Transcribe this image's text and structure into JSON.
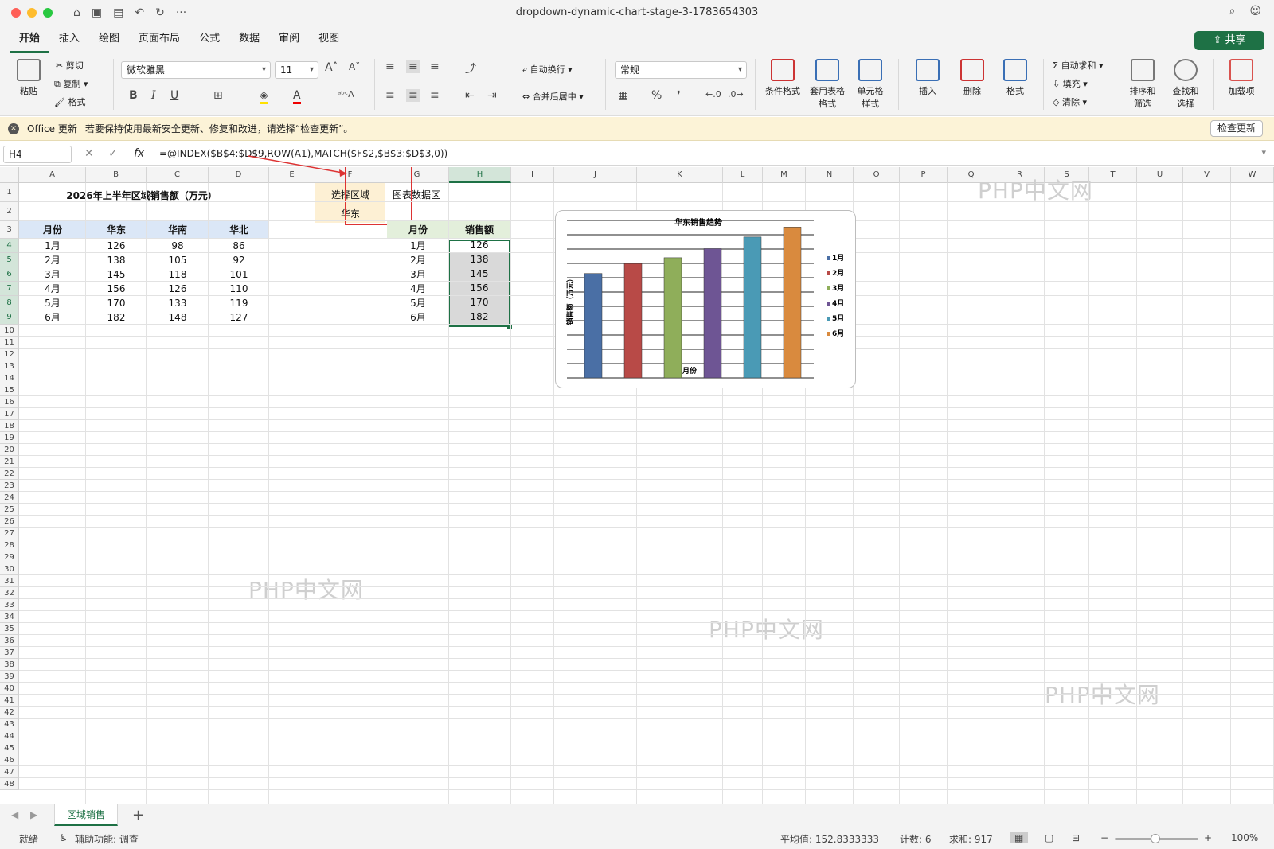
{
  "window": {
    "title": "dropdown-dynamic-chart-stage-3-1783654303"
  },
  "tabs": [
    "开始",
    "插入",
    "绘图",
    "页面布局",
    "公式",
    "数据",
    "审阅",
    "视图"
  ],
  "share_label": "共享",
  "ribbon": {
    "paste": "粘贴",
    "cut": "剪切",
    "copy": "复制",
    "format_painter": "格式",
    "font_name": "微软雅黑",
    "font_size": "11",
    "bold": "B",
    "italic": "I",
    "underline": "U",
    "wrap_text": "自动换行",
    "merge_center": "合并后居中",
    "number_format": "常规",
    "percent": "%",
    "comma": "❜",
    "conditional_format": "条件格式",
    "format_table_1": "套用表格",
    "format_table_2": "格式",
    "cell_style_1": "单元格",
    "cell_style_2": "样式",
    "insert": "插入",
    "delete": "删除",
    "format": "格式",
    "autosum": "自动求和",
    "fill": "填充",
    "clear": "清除",
    "sort_1": "排序和",
    "sort_2": "筛选",
    "find_1": "查找和",
    "find_2": "选择",
    "addins": "加载项"
  },
  "message": {
    "app": "Office 更新",
    "text": "若要保持使用最新安全更新、修复和改进，请选择“检查更新”。",
    "button": "检查更新"
  },
  "formula_bar": {
    "name_box": "H4",
    "fx": "fx",
    "formula": "=@INDEX($B$4:$D$9,ROW(A1),MATCH($F$2,$B$3:$D$3,0))"
  },
  "columns": [
    "A",
    "B",
    "C",
    "D",
    "E",
    "F",
    "G",
    "H",
    "I",
    "J",
    "K",
    "L",
    "M",
    "N",
    "O",
    "P",
    "Q",
    "R",
    "S",
    "T",
    "U",
    "V",
    "W"
  ],
  "rows": [
    "1",
    "2",
    "3",
    "4",
    "5",
    "6",
    "7",
    "8",
    "9",
    "10",
    "11",
    "12",
    "13",
    "14",
    "15",
    "16",
    "17",
    "18",
    "19",
    "20",
    "21",
    "22",
    "23",
    "24",
    "25",
    "26",
    "27",
    "28",
    "29",
    "30",
    "31",
    "32",
    "33",
    "34",
    "35",
    "36",
    "37",
    "38",
    "39",
    "40",
    "41",
    "42",
    "43",
    "44",
    "45",
    "46",
    "47",
    "48"
  ],
  "sheet": {
    "title": "2026年上半年区域销售额（万元）",
    "headers": [
      "月份",
      "华东",
      "华南",
      "华北"
    ],
    "data": [
      [
        "1月",
        "126",
        "98",
        "86"
      ],
      [
        "2月",
        "138",
        "105",
        "92"
      ],
      [
        "3月",
        "145",
        "118",
        "101"
      ],
      [
        "4月",
        "156",
        "126",
        "110"
      ],
      [
        "5月",
        "170",
        "133",
        "119"
      ],
      [
        "6月",
        "182",
        "148",
        "127"
      ]
    ],
    "select_label": "选择区域",
    "select_value": "华东",
    "chart_area_label": "图表数据区",
    "chart_headers": [
      "月份",
      "销售额"
    ],
    "chart_rows": [
      [
        "1月",
        "126"
      ],
      [
        "2月",
        "138"
      ],
      [
        "3月",
        "145"
      ],
      [
        "4月",
        "156"
      ],
      [
        "5月",
        "170"
      ],
      [
        "6月",
        "182"
      ]
    ]
  },
  "chart_data": {
    "type": "bar",
    "title": "华东销售趋势",
    "xlabel": "月份",
    "ylabel": "销售额（万元）",
    "categories": [
      "1月",
      "2月",
      "3月",
      "4月",
      "5月",
      "6月"
    ],
    "values": [
      126,
      138,
      145,
      156,
      170,
      182
    ],
    "colors": [
      "#4a6fa5",
      "#b84a47",
      "#8fae5a",
      "#6e5594",
      "#4a9ab5",
      "#d98a3e"
    ],
    "legend": [
      "1月",
      "2月",
      "3月",
      "4月",
      "5月",
      "6月"
    ],
    "legend_position": "right",
    "grid": true
  },
  "watermark": "PHP中文网",
  "sheet_tab": "区域销售",
  "status": {
    "ready": "就绪",
    "accessibility": "辅助功能: 调查",
    "average": "平均值: 152.8333333",
    "count": "计数: 6",
    "sum": "求和: 917",
    "zoom": "100%"
  }
}
